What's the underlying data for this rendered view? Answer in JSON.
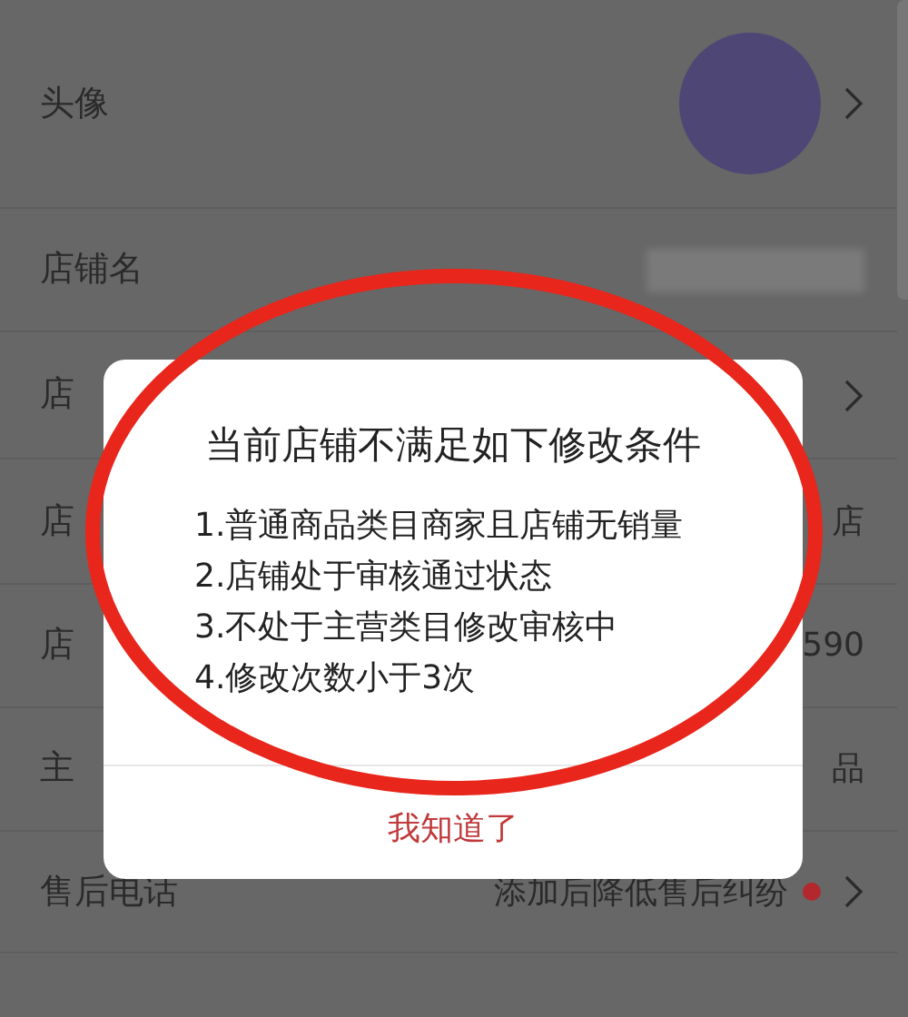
{
  "settings_rows": [
    {
      "label": "头像",
      "kind": "avatar",
      "chevron": true
    },
    {
      "label": "店铺名",
      "kind": "redacted",
      "chevron": false
    },
    {
      "label": "店",
      "kind": "plain",
      "chevron": true
    },
    {
      "label": "店",
      "kind": "text",
      "value": "店",
      "chevron": false
    },
    {
      "label": "店",
      "kind": "text",
      "value": "590",
      "chevron": false
    },
    {
      "label": "主",
      "kind": "text",
      "value": "品",
      "chevron": false
    },
    {
      "label": "售后电话",
      "kind": "text",
      "value": "添加后降低售后纠纷",
      "badge_dot": true,
      "chevron": true
    }
  ],
  "dialog": {
    "title": "当前店铺不满足如下修改条件",
    "conditions": [
      "1.普通商品类目商家且店铺无销量",
      "2.店铺处于审核通过状态",
      "3.不处于主营类目修改审核中",
      "4.修改次数小于3次"
    ],
    "button": "我知道了"
  }
}
